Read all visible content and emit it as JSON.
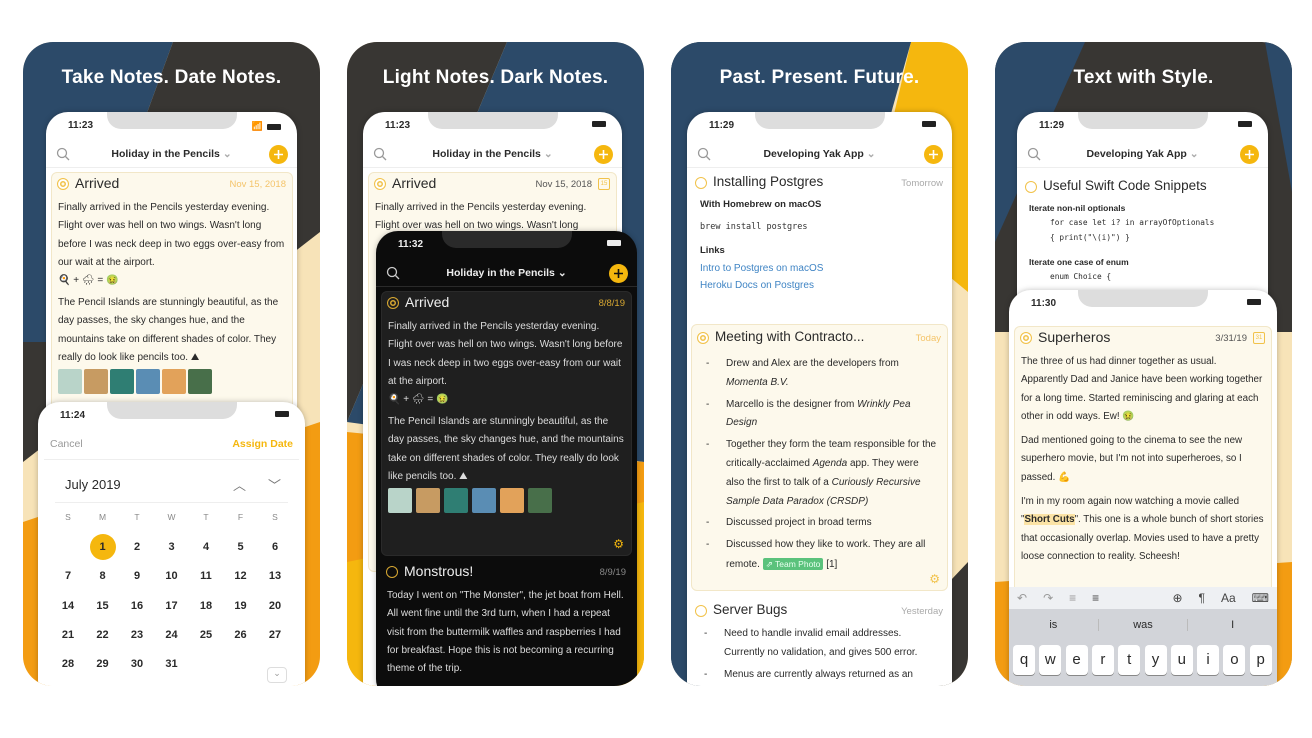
{
  "colors": {
    "accent": "#f5b70e",
    "navy": "#2c4a69",
    "dark": "#383633",
    "cream": "#f7e3b8",
    "orange": "#f39c12",
    "link": "#3f84c4",
    "tag": "#5bc27c"
  },
  "panel1": {
    "headline": "Take Notes. Date Notes.",
    "phone": {
      "time": "11:23",
      "title": "Holiday in the Pencils",
      "note": {
        "title": "Arrived",
        "date": "Nov 15, 2018",
        "p1": "Finally arrived in the Pencils yesterday evening. Flight over was hell on two wings. Wasn't long before I was neck deep in two eggs over-easy from our wait at the airport.",
        "emoji": "🍳 + 🌧 = 🤢",
        "p2": "The Pencil Islands are stunningly beautiful, as the day passes, the sky changes hue, and the mountains take on different shades of color. They really do look like pencils too. ⛰"
      }
    },
    "calendar": {
      "time": "11:24",
      "cancel": "Cancel",
      "assign": "Assign Date",
      "month": "July 2019",
      "weekdays": [
        "S",
        "M",
        "T",
        "W",
        "T",
        "F",
        "S"
      ],
      "first_weekday": 1,
      "days": 31,
      "selected": 1
    }
  },
  "panel2": {
    "headline": "Light Notes. Dark Notes.",
    "light": {
      "time": "11:23",
      "title": "Holiday in the Pencils",
      "note_title": "Arrived",
      "note_date": "Nov 15, 2018",
      "calendar_badge": "15",
      "p1": "Finally arrived in the Pencils yesterday evening. Flight over was hell on two wings. Wasn't long"
    },
    "dark": {
      "time": "11:32",
      "title": "Holiday in the Pencils",
      "note1": {
        "title": "Arrived",
        "date": "8/8/19",
        "p1": "Finally arrived in the Pencils yesterday evening. Flight over was hell on two wings. Wasn't long before I was neck deep in two eggs over-easy from our wait at the airport.",
        "emoji": "🍳 + 🌧 = 🤢",
        "p2": "The Pencil Islands are stunningly beautiful, as the day passes, the sky changes hue, and the mountains take on different shades of color. They really do look like pencils too. ⛰"
      },
      "note2": {
        "title": "Monstrous!",
        "date": "8/9/19",
        "p1": "Today I went on \"The Monster\", the jet boat from Hell. All went fine until the 3rd turn, when I had a repeat visit from the buttermilk waffles and raspberries I had for breakfast. Hope this is not becoming a recurring theme of the trip."
      }
    }
  },
  "panel3": {
    "headline": "Past. Present. Future.",
    "time": "11:29",
    "title": "Developing Yak App",
    "note1": {
      "title": "Installing Postgres",
      "date": "Tomorrow",
      "heading": "With Homebrew on macOS",
      "code": "brew install postgres",
      "links_heading": "Links",
      "links": [
        "Intro to Postgres on macOS",
        "Heroku Docs on Postgres"
      ]
    },
    "note2": {
      "title": "Meeting with Contracto...",
      "date": "Today",
      "items": [
        {
          "a": "Drew and Alex are the developers from ",
          "i": "Momenta B.V.",
          "b": ""
        },
        {
          "a": "Marcello is the designer from ",
          "i": "Wrinkly Pea Design",
          "b": ""
        },
        {
          "a": "Together they form the team responsible for the critically-acclaimed ",
          "i": "Agenda",
          "b": " app. They were also the first to talk of a "
        },
        {
          "a": "Discussed project in broad terms",
          "i": "",
          "b": ""
        },
        {
          "a": "Discussed how they like to work. They are all remote. ",
          "i": "",
          "b": ""
        }
      ],
      "item3_italic2": "Curiously Recursive Sample Data Paradox (CRSDP)",
      "tag": "Team Photo",
      "ref": "[1]"
    },
    "note3": {
      "title": "Server Bugs",
      "date": "Yesterday",
      "items": [
        "Need to handle invalid email addresses. Currently no validation, and gives 500 error.",
        "Menus are currently always returned as an"
      ]
    }
  },
  "panel4": {
    "headline": "Text with Style.",
    "back": {
      "time": "11:29",
      "title": "Developing Yak App",
      "note_title": "Useful Swift Code Snippets",
      "h1": "Iterate non-nil optionals",
      "code1": "for case let i? in arrayOfOptionals",
      "code2": "{ print(\"\\(i)\") }",
      "h2": "Iterate one case of enum",
      "code3": "enum Choice {"
    },
    "front": {
      "time": "11:30",
      "note_title": "Superheros",
      "date": "3/31/19",
      "calendar_badge": "31",
      "p1": "The three of us had dinner together as usual. Apparently Dad and Janice have been working together for a long time. Started reminiscing and glaring at each other in odd ways. Ew! 🤢",
      "p2": "Dad mentioned going to the cinema to see the new superhero movie, but I'm not into superheroes, so I passed. 💪",
      "p3a": "I'm in my room again now watching a movie called \"",
      "p3sel": "Short Cuts",
      "p3b": "\". This one is a whole bunch of short stories that occasionally overlap. Movies used to have a pretty loose connection to reality. Scheesh!",
      "suggestions": [
        "is",
        "was",
        "I"
      ],
      "keys": [
        "q",
        "w",
        "e",
        "r",
        "t",
        "y",
        "u",
        "i",
        "o",
        "p"
      ]
    }
  }
}
